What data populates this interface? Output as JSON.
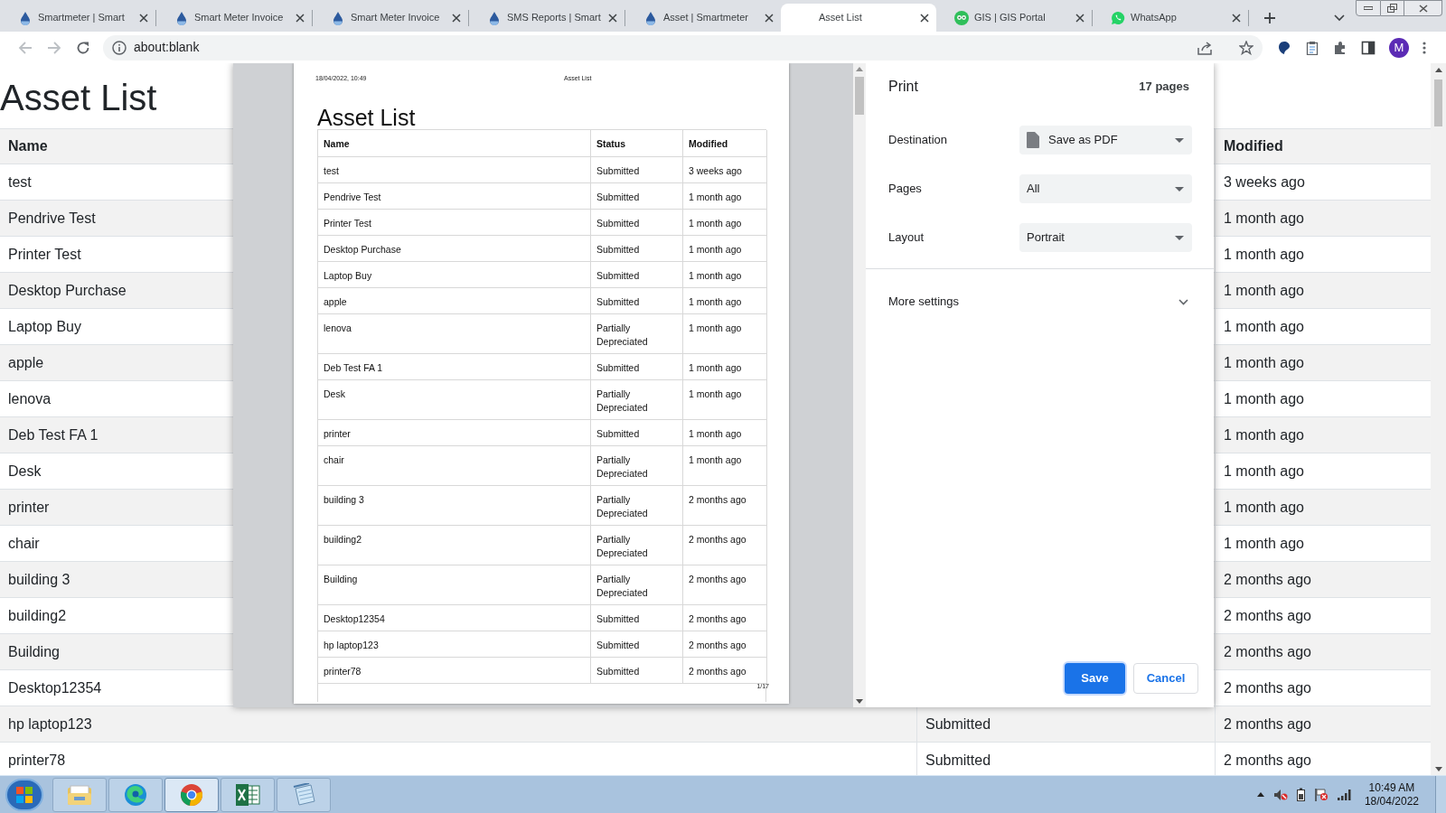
{
  "browser": {
    "tabs": [
      {
        "title": "Smartmeter | Smart",
        "kind": "droplet",
        "selected": false
      },
      {
        "title": "Smart Meter Invoice",
        "kind": "droplet",
        "selected": false
      },
      {
        "title": "Smart Meter Invoice",
        "kind": "droplet",
        "selected": false
      },
      {
        "title": "SMS Reports | Smart",
        "kind": "droplet",
        "selected": false
      },
      {
        "title": "Asset | Smartmeter",
        "kind": "droplet",
        "selected": false
      },
      {
        "title": "Asset List",
        "kind": "blank",
        "selected": true
      },
      {
        "title": "GIS | GIS Portal",
        "kind": "owl",
        "selected": false
      },
      {
        "title": "WhatsApp",
        "kind": "chat",
        "selected": false
      }
    ],
    "nav": [
      {
        "kind": "back",
        "disabled": true
      },
      {
        "kind": "forward",
        "disabled": true
      },
      {
        "kind": "reload",
        "disabled": false
      }
    ],
    "address": "about:blank",
    "profile_initial": "M"
  },
  "page": {
    "title": "Asset List",
    "header": {
      "name": "Name",
      "modified": "Modified"
    },
    "rows": [
      {
        "name": "test",
        "modified": "3 weeks ago"
      },
      {
        "name": "Pendrive Test",
        "modified": "1 month ago"
      },
      {
        "name": "Printer Test",
        "modified": "1 month ago"
      },
      {
        "name": "Desktop Purchase",
        "modified": "1 month ago"
      },
      {
        "name": "Laptop Buy",
        "modified": "1 month ago"
      },
      {
        "name": "apple",
        "modified": "1 month ago"
      },
      {
        "name": "lenova",
        "modified": "1 month ago"
      },
      {
        "name": "Deb Test FA 1",
        "modified": "1 month ago"
      },
      {
        "name": "Desk",
        "modified": "1 month ago"
      },
      {
        "name": "printer",
        "modified": "1 month ago"
      },
      {
        "name": "chair",
        "modified": "1 month ago"
      },
      {
        "name": "building 3",
        "modified": "2 months ago"
      },
      {
        "name": "building2",
        "modified": "2 months ago"
      },
      {
        "name": "Building",
        "modified": "2 months ago"
      },
      {
        "name": "Desktop12354",
        "modified": "2 months ago"
      },
      {
        "name": "hp laptop123",
        "status": "Submitted",
        "modified": "2 months ago"
      },
      {
        "name": "printer78",
        "status": "Submitted",
        "modified": "2 months ago"
      }
    ]
  },
  "print_preview": {
    "header_date": "18/04/2022, 10:49",
    "header_title": "Asset List",
    "title": "Asset List",
    "columns": [
      "Name",
      "Status",
      "Modified"
    ],
    "rows": [
      {
        "name": "test",
        "status": "Submitted",
        "modified": "3 weeks ago"
      },
      {
        "name": "Pendrive Test",
        "status": "Submitted",
        "modified": "1 month ago"
      },
      {
        "name": "Printer Test",
        "status": "Submitted",
        "modified": "1 month ago"
      },
      {
        "name": "Desktop Purchase",
        "status": "Submitted",
        "modified": "1 month ago"
      },
      {
        "name": "Laptop Buy",
        "status": "Submitted",
        "modified": "1 month ago"
      },
      {
        "name": "apple",
        "status": "Submitted",
        "modified": "1 month ago"
      },
      {
        "name": "lenova",
        "status": "Partially Depreciated",
        "modified": "1 month ago"
      },
      {
        "name": "Deb Test FA 1",
        "status": "Submitted",
        "modified": "1 month ago"
      },
      {
        "name": "Desk",
        "status": "Partially Depreciated",
        "modified": "1 month ago"
      },
      {
        "name": "printer",
        "status": "Submitted",
        "modified": "1 month ago"
      },
      {
        "name": "chair",
        "status": "Partially Depreciated",
        "modified": "1 month ago"
      },
      {
        "name": "building 3",
        "status": "Partially Depreciated",
        "modified": "2 months ago"
      },
      {
        "name": "building2",
        "status": "Partially Depreciated",
        "modified": "2 months ago"
      },
      {
        "name": "Building",
        "status": "Partially Depreciated",
        "modified": "2 months ago"
      },
      {
        "name": "Desktop12354",
        "status": "Submitted",
        "modified": "2 months ago"
      },
      {
        "name": "hp laptop123",
        "status": "Submitted",
        "modified": "2 months ago"
      },
      {
        "name": "printer78",
        "status": "Submitted",
        "modified": "2 months ago"
      }
    ],
    "page_number": "1/17"
  },
  "print_dialog": {
    "title": "Print",
    "page_count": "17 pages",
    "settings": [
      {
        "label": "Destination",
        "value": "Save as PDF",
        "kind": "destination"
      },
      {
        "label": "Pages",
        "value": "All",
        "kind": "select"
      },
      {
        "label": "Layout",
        "value": "Portrait",
        "kind": "select"
      }
    ],
    "more_settings": {
      "label": "More settings",
      "expanded": false
    },
    "buttons": [
      {
        "label": "Save",
        "kind": "primary"
      },
      {
        "label": "Cancel",
        "kind": "secondary"
      }
    ]
  },
  "taskbar": {
    "apps": [
      {
        "kind": "explorer",
        "selected": false
      },
      {
        "kind": "edge",
        "selected": false
      },
      {
        "kind": "chrome",
        "selected": true
      },
      {
        "kind": "excel",
        "selected": false
      },
      {
        "kind": "notepad",
        "selected": false
      }
    ],
    "time": "10:49 AM",
    "date": "18/04/2022"
  }
}
